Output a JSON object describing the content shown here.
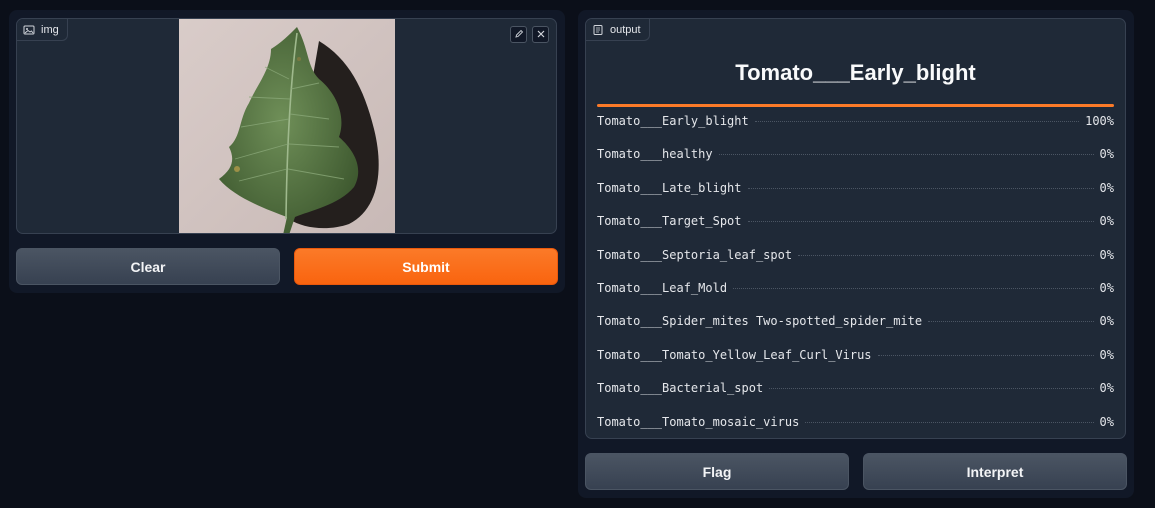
{
  "input": {
    "label": "img",
    "label_icon": "image-icon",
    "edit_icon": "pencil-icon",
    "close_icon": "close-icon",
    "image_description_icon": "tomato-leaf-image"
  },
  "buttons": {
    "clear": "Clear",
    "submit": "Submit",
    "flag": "Flag",
    "interpret": "Interpret"
  },
  "output": {
    "label": "output",
    "label_icon": "label-icon",
    "predicted": "Tomato___Early_blight",
    "confidences": [
      {
        "label": "Tomato___Early_blight",
        "value": "100%",
        "fraction": 1.0
      },
      {
        "label": "Tomato___healthy",
        "value": "0%",
        "fraction": 0.0
      },
      {
        "label": "Tomato___Late_blight",
        "value": "0%",
        "fraction": 0.0
      },
      {
        "label": "Tomato___Target_Spot",
        "value": "0%",
        "fraction": 0.0
      },
      {
        "label": "Tomato___Septoria_leaf_spot",
        "value": "0%",
        "fraction": 0.0
      },
      {
        "label": "Tomato___Leaf_Mold",
        "value": "0%",
        "fraction": 0.0
      },
      {
        "label": "Tomato___Spider_mites Two-spotted_spider_mite",
        "value": "0%",
        "fraction": 0.0
      },
      {
        "label": "Tomato___Tomato_Yellow_Leaf_Curl_Virus",
        "value": "0%",
        "fraction": 0.0
      },
      {
        "label": "Tomato___Bacterial_spot",
        "value": "0%",
        "fraction": 0.0
      },
      {
        "label": "Tomato___Tomato_mosaic_virus",
        "value": "0%",
        "fraction": 0.0
      }
    ]
  },
  "colors": {
    "background": "#0b0f19",
    "panel": "#111827",
    "block": "#1f2937",
    "accent": "#f97316",
    "secondary_button": "#4b5563"
  }
}
